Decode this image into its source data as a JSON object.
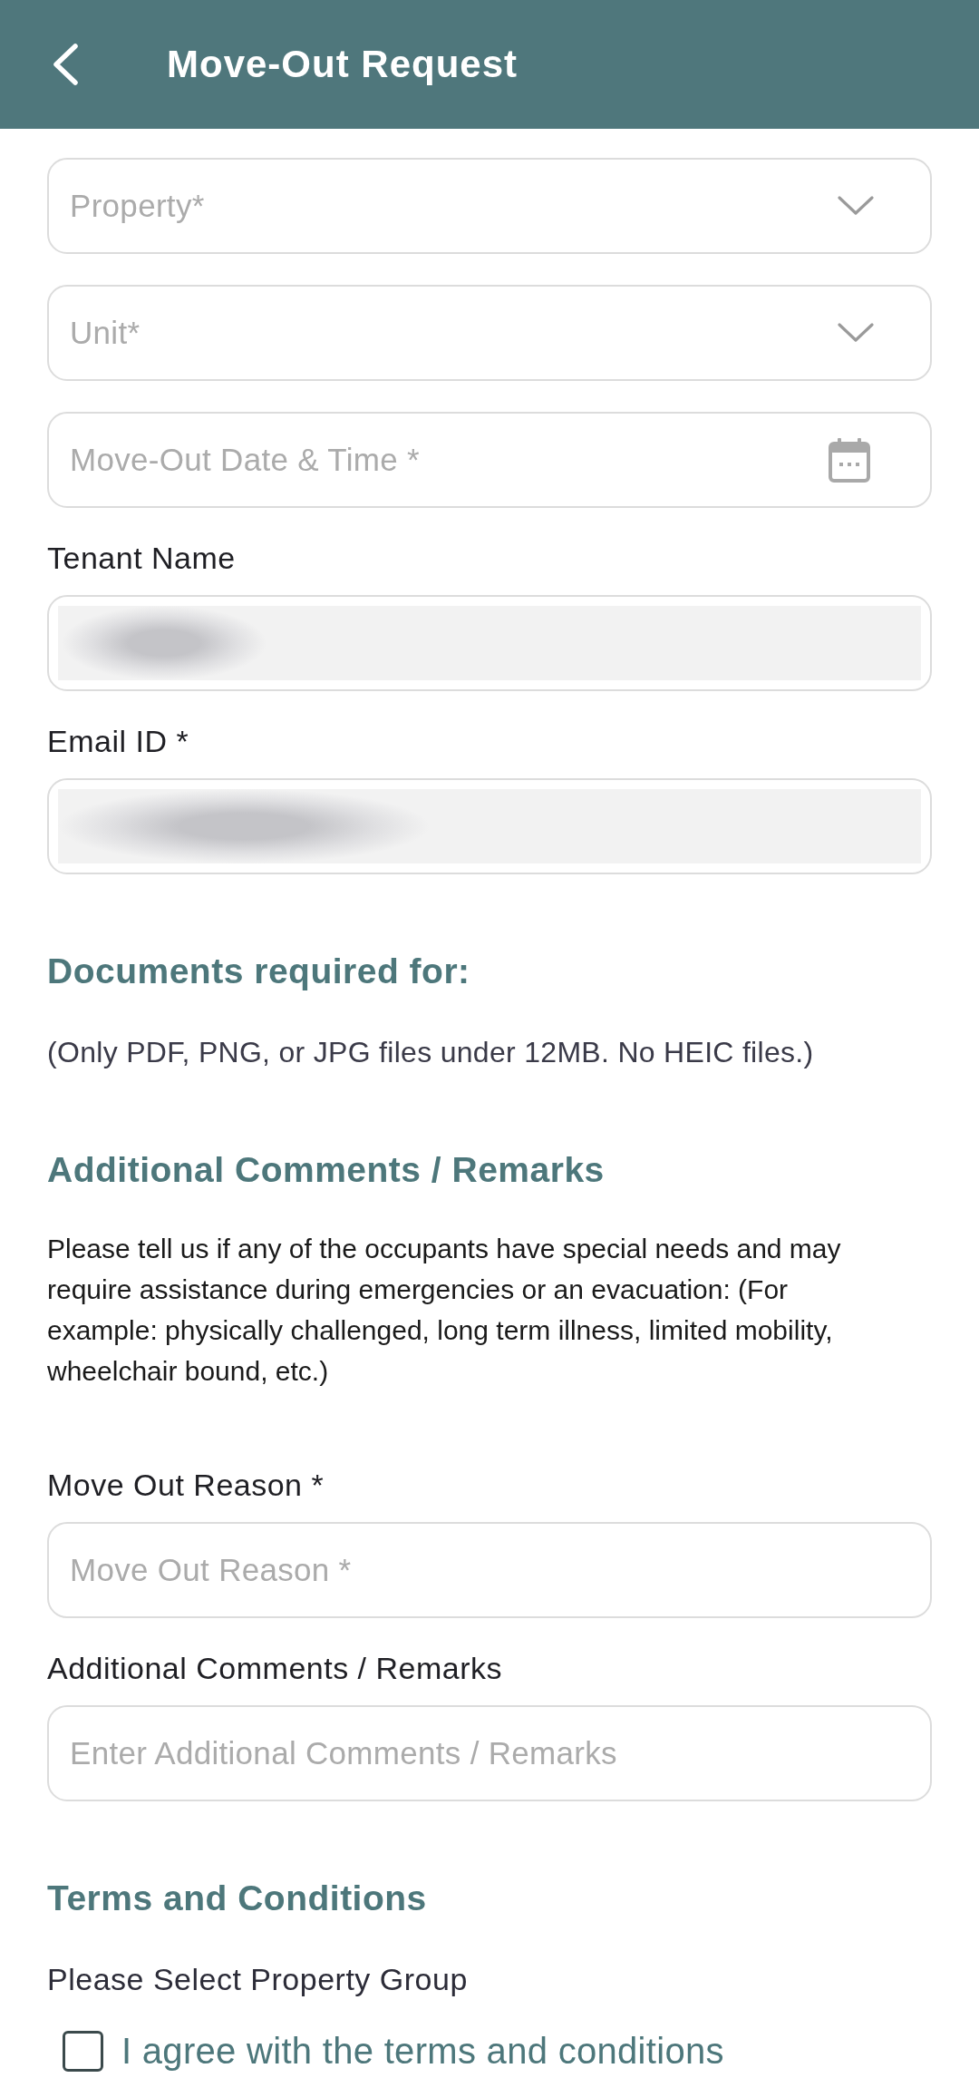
{
  "header": {
    "title": "Move-Out Request"
  },
  "fields": [
    {
      "kind": "dropdown",
      "placeholder": "Property*",
      "disabled": false
    },
    {
      "kind": "dropdown",
      "placeholder": "Unit*",
      "disabled": false
    },
    {
      "kind": "date",
      "placeholder": "Move-Out Date & Time *",
      "disabled": false
    },
    {
      "kind": "readonly",
      "label": "Tenant Name",
      "disabled": true,
      "redacted": true
    },
    {
      "kind": "readonly",
      "label": "Email ID *",
      "disabled": true,
      "redacted": true
    }
  ],
  "documents_section": {
    "heading": "Documents required for:",
    "note": "(Only PDF, PNG, or JPG files under 12MB. No HEIC files.)"
  },
  "comments_section": {
    "heading": "Additional Comments / Remarks",
    "description": "Please tell us if any of the occupants have special needs and may require assistance during emergencies or an evacuation: (For example: physically challenged, long term illness, limited mobility, wheelchair bound, etc.)",
    "fields": [
      {
        "kind": "text",
        "label": "Move Out Reason *",
        "placeholder": "Move Out Reason *",
        "disabled": false
      },
      {
        "kind": "text",
        "label": "Additional Comments / Remarks",
        "placeholder": "Enter Additional Comments / Remarks",
        "disabled": false
      }
    ]
  },
  "terms_section": {
    "heading": "Terms and Conditions",
    "prompt": "Please Select Property Group",
    "agreement": {
      "label": "I agree with the terms and conditions",
      "checked": false
    }
  }
}
